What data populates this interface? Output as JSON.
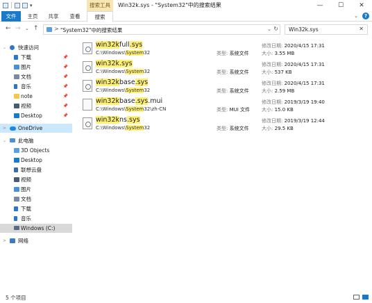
{
  "window": {
    "title": "Win32k.sys - \"System32\"中的搜索结果",
    "context_tab": "搜索工具",
    "minimize": "—",
    "maximize": "☐",
    "close": "✕"
  },
  "ribbon": {
    "tabs": [
      "文件",
      "主页",
      "共享",
      "查看",
      "搜索"
    ],
    "expand": "⌄",
    "help": "?"
  },
  "address": {
    "back": "←",
    "forward": "→",
    "recent": "⌄",
    "up": "↑",
    "separator": ">",
    "path": "\"System32\"中的搜索结果",
    "dropdown": "⌄",
    "refresh": "↻"
  },
  "search": {
    "value": "Win32k.sys",
    "clear": "✕"
  },
  "nav": {
    "items": [
      {
        "label": "快速访问",
        "icon": "star-icon",
        "expander": "⌄",
        "pinned": false
      },
      {
        "label": "下载",
        "icon": "download-icon",
        "pinned": true
      },
      {
        "label": "图片",
        "icon": "pictures-icon",
        "pinned": true
      },
      {
        "label": "文档",
        "icon": "documents-icon",
        "pinned": true
      },
      {
        "label": "音乐",
        "icon": "music-icon",
        "pinned": true
      },
      {
        "label": "note",
        "icon": "folder-icon",
        "pinned": true
      },
      {
        "label": "视频",
        "icon": "videos-icon",
        "pinned": true
      },
      {
        "label": "Desktop",
        "icon": "desktop-icon",
        "pinned": true
      },
      {
        "label": "OneDrive",
        "icon": "onedrive-icon",
        "expander": ">"
      },
      {
        "label": "此电脑",
        "icon": "this-pc-icon",
        "expander": "⌄"
      },
      {
        "label": "3D Objects",
        "icon": "3d-objects-icon"
      },
      {
        "label": "Desktop",
        "icon": "desktop-icon"
      },
      {
        "label": "联想云盘",
        "icon": "cloud-drive-icon"
      },
      {
        "label": "视频",
        "icon": "videos-icon"
      },
      {
        "label": "图片",
        "icon": "pictures-icon"
      },
      {
        "label": "文档",
        "icon": "documents-icon"
      },
      {
        "label": "下载",
        "icon": "download-icon"
      },
      {
        "label": "音乐",
        "icon": "music-icon"
      },
      {
        "label": "Windows (C:)",
        "icon": "drive-icon"
      },
      {
        "label": "网络",
        "icon": "network-icon",
        "expander": ">"
      }
    ],
    "pin_glyph": "📌"
  },
  "labels": {
    "type": "类型: ",
    "modified": "修改日期: ",
    "size": "大小: "
  },
  "results": [
    {
      "name_pre": "",
      "name_hl": "win32k",
      "name_mid": "full",
      "name_hl2": ".sys",
      "name_post": "",
      "path_pre": "C:\\Windows\\",
      "path_hl": "System",
      "path_post": "32",
      "type": "系统文件",
      "modified": "2020/4/15 17:31",
      "size": "3.55 MB",
      "icon": "system-file-icon"
    },
    {
      "name_pre": "",
      "name_hl": "win32k",
      "name_mid": "",
      "name_hl2": ".sys",
      "name_post": "",
      "path_pre": "C:\\Windows\\",
      "path_hl": "System",
      "path_post": "32",
      "type": "系统文件",
      "modified": "2020/4/15 17:31",
      "size": "537 KB",
      "icon": "system-file-icon"
    },
    {
      "name_pre": "",
      "name_hl": "win32k",
      "name_mid": "base",
      "name_hl2": ".sys",
      "name_post": "",
      "path_pre": "C:\\Windows\\",
      "path_hl": "System",
      "path_post": "32",
      "type": "系统文件",
      "modified": "2020/4/15 17:31",
      "size": "2.59 MB",
      "icon": "system-file-icon"
    },
    {
      "name_pre": "",
      "name_hl": "win32k",
      "name_mid": "base",
      "name_hl2": ".sys",
      "name_post": ".mui",
      "path_pre": "C:\\Windows\\",
      "path_hl": "System",
      "path_post": "32\\zh-CN",
      "type": "MUI 文件",
      "modified": "2019/3/19 19:40",
      "size": "15.0 KB",
      "icon": "file-icon"
    },
    {
      "name_pre": "",
      "name_hl": "win32k",
      "name_mid": "ns",
      "name_hl2": ".sys",
      "name_post": "",
      "path_pre": "C:\\Windows\\",
      "path_hl": "System",
      "path_post": "32",
      "type": "系统文件",
      "modified": "2019/3/19 12:44",
      "size": "29.5 KB",
      "icon": "system-file-icon"
    }
  ],
  "status": {
    "count": "5 个项目"
  },
  "colors": {
    "accent": "#1979ca",
    "highlight": "#fff176",
    "context_tab": "#f7e6b4",
    "selected": "#cce8ff"
  }
}
